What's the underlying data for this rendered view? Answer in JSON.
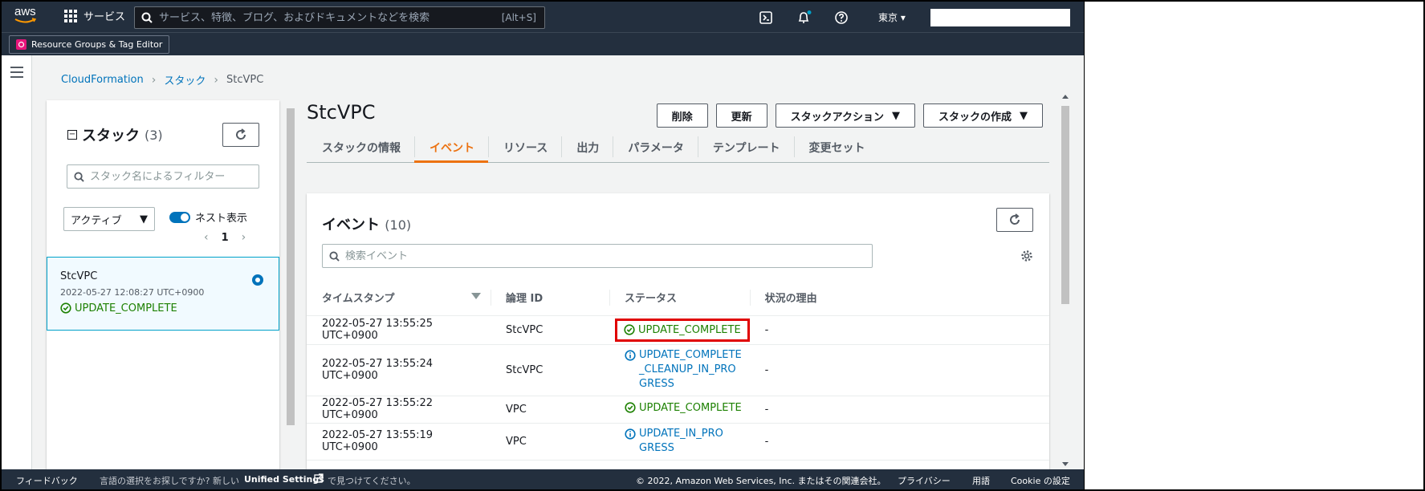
{
  "topnav": {
    "logo_text": "aws",
    "services_label": "サービス",
    "search_placeholder": "サービス、特徴、ブログ、およびドキュメントなどを検索",
    "search_shortcut": "[Alt+S]",
    "region": "東京"
  },
  "favorites": {
    "resource_groups": "Resource Groups & Tag Editor"
  },
  "breadcrumb": {
    "items": [
      "CloudFormation",
      "スタック",
      "StcVPC"
    ]
  },
  "stacks_panel": {
    "title": "スタック",
    "count": "(3)",
    "filter_placeholder": "スタック名によるフィルター",
    "filter_select": "アクティブ",
    "nested_toggle_label": "ネスト表示",
    "page": "1",
    "selected_stack": {
      "name": "StcVPC",
      "timestamp": "2022-05-27 12:08:27 UTC+0900",
      "status": "UPDATE_COMPLETE"
    }
  },
  "detail": {
    "stack_name": "StcVPC",
    "actions": {
      "delete": "削除",
      "update": "更新",
      "stack_actions": "スタックアクション",
      "create_stack": "スタックの作成"
    },
    "tabs": [
      "スタックの情報",
      "イベント",
      "リソース",
      "出力",
      "パラメータ",
      "テンプレート",
      "変更セット"
    ],
    "active_tab": "イベント"
  },
  "events": {
    "title": "イベント",
    "count": "(10)",
    "search_placeholder": "検索イベント",
    "columns": [
      "タイムスタンプ",
      "論理 ID",
      "ステータス",
      "状況の理由"
    ],
    "rows": [
      {
        "timestamp": "2022-05-27 13:55:25 UTC+0900",
        "logical_id": "StcVPC",
        "status": "UPDATE_COMPLETE",
        "reason": "-"
      },
      {
        "timestamp": "2022-05-27 13:55:24 UTC+0900",
        "logical_id": "StcVPC",
        "status": "UPDATE_COMPLETE_CLEANUP_IN_PROGRESS",
        "reason": "-"
      },
      {
        "timestamp": "2022-05-27 13:55:22 UTC+0900",
        "logical_id": "VPC",
        "status": "UPDATE_COMPLETE",
        "reason": "-"
      },
      {
        "timestamp": "2022-05-27 13:55:19 UTC+0900",
        "logical_id": "VPC",
        "status": "UPDATE_IN_PROGRESS",
        "reason": "-"
      }
    ]
  },
  "footer": {
    "feedback": "フィードバック",
    "lang_prompt": "言語の選択をお探しですか? 新しい",
    "unified_settings": "Unified Settings",
    "lang_suffix": "で見つけてください。",
    "copyright": "© 2022, Amazon Web Services, Inc. またはその関連会社。",
    "privacy": "プライバシー",
    "terms": "用語",
    "cookie": "Cookie の設定"
  },
  "colors": {
    "nav_bg": "#232f3e",
    "link": "#0073bb",
    "success": "#1d8102",
    "active_tab": "#ec7211",
    "highlight_border": "#e00000"
  }
}
